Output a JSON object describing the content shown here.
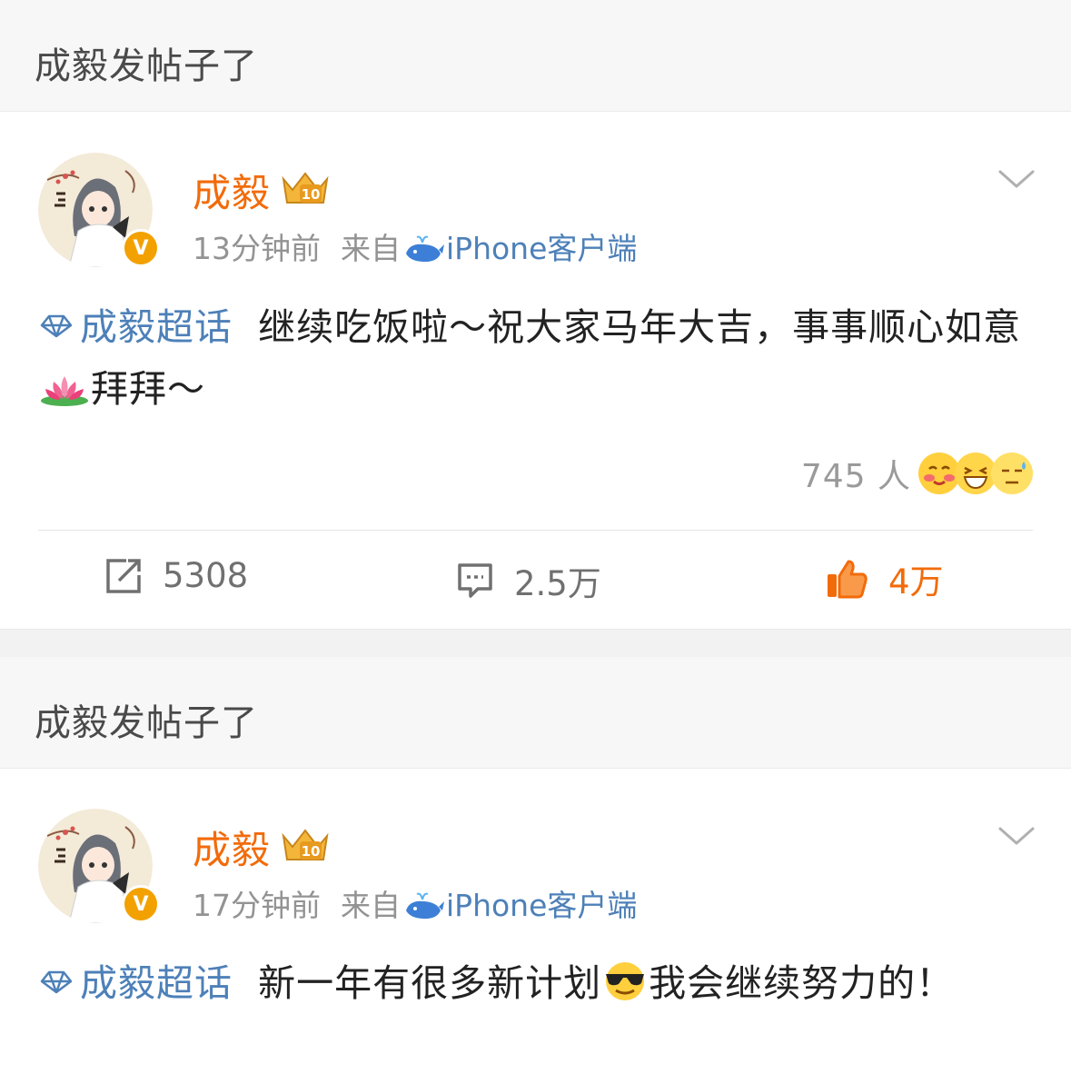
{
  "posts": [
    {
      "header_title": "成毅发帖子了",
      "username": "成毅",
      "level": "10",
      "verified": "V",
      "time": "13分钟前",
      "source_label": "来自",
      "client": "iPhone客户端",
      "topic": "成毅超话",
      "text_a": "继续吃饭啦～祝大家马年大吉，事事顺心如意",
      "text_b": "拜拜～",
      "inline_emoji": "lotus-icon",
      "reaction_count": "745 人",
      "reposts": "5308",
      "comments": "2.5万",
      "likes": "4万"
    },
    {
      "header_title": "成毅发帖子了",
      "username": "成毅",
      "level": "10",
      "verified": "V",
      "time": "17分钟前",
      "source_label": "来自",
      "client": "iPhone客户端",
      "topic": "成毅超话",
      "text_a": "新一年有很多新计划",
      "text_b": "我会继续努力的！",
      "inline_emoji": "cool-face-icon"
    }
  ],
  "colors": {
    "username": "#f26b0a",
    "link": "#4d80b8",
    "meta": "#939393",
    "header_bg": "#f7f7f7"
  }
}
